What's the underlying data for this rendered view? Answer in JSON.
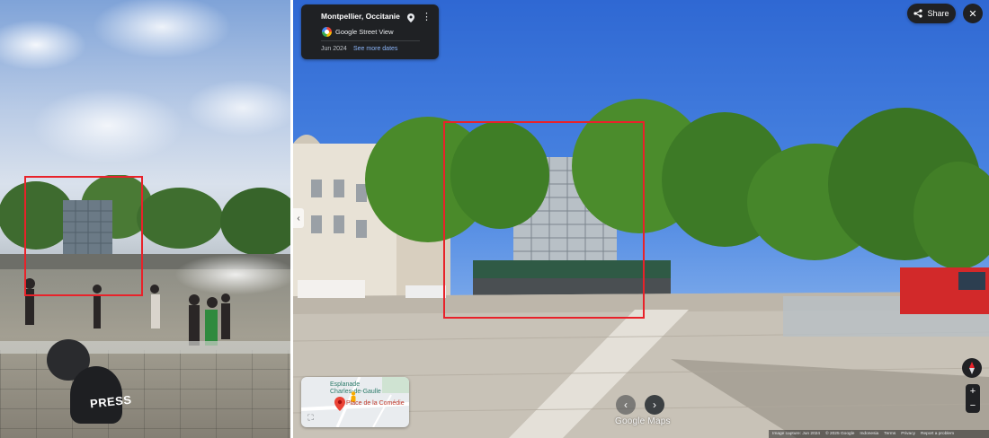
{
  "streetview": {
    "location": "Montpellier, Occitanie",
    "source": "Google Street View",
    "date": "Jun 2024",
    "see_more": "See more dates",
    "share_label": "Share",
    "watermark": "Google Maps",
    "icons": [
      "pin-icon",
      "more-vert-icon",
      "share-icon",
      "close-icon",
      "chevron-left-icon",
      "chevron-right-icon",
      "compass-icon",
      "expand-icon",
      "map-pin-icon"
    ]
  },
  "minimap": {
    "label_line1": "Esplanade",
    "label_line2": "Charles-de-Gaulle",
    "place": "Place de la Comédie"
  },
  "zoom": {
    "in": "+",
    "out": "−"
  },
  "footer": {
    "capture": "Image capture: Jun 2024",
    "copyright": "© 2025 Google",
    "country": "Indonesia",
    "terms": "Terms",
    "privacy": "Privacy",
    "report": "Report a problem"
  },
  "left_photo": {
    "badge": "PRESS"
  },
  "colors": {
    "highlight_box": "#e8222a",
    "card_bg": "#1f2124",
    "link": "#8ab4f8"
  }
}
